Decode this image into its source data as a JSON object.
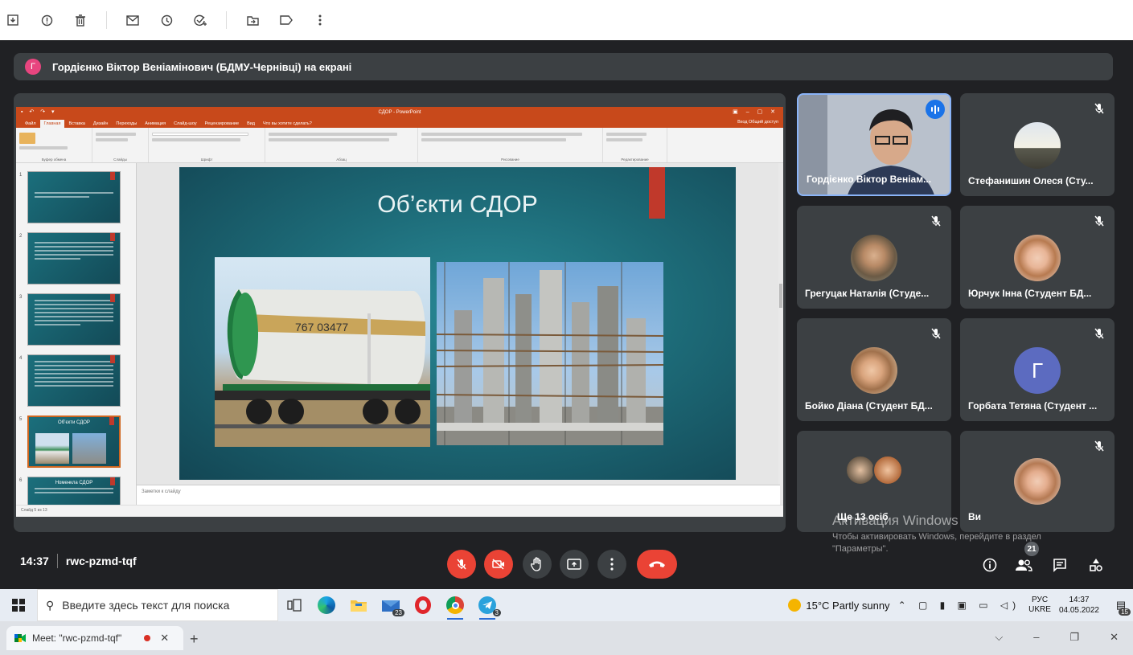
{
  "banner": {
    "avatar_letter": "Г",
    "text": "Гордієнко Віктор Веніамінович (БДМУ-Чернівці) на екрані"
  },
  "ppt": {
    "title": "СДОР - PowerPoint",
    "tabs": [
      "Файл",
      "Главная",
      "Вставка",
      "Дизайн",
      "Переходы",
      "Анимация",
      "Слайд-шоу",
      "Рецензирование",
      "Вид",
      "Что вы хотите сделать?"
    ],
    "right": "Вход  Общий доступ",
    "groups": [
      "Буфер обмена",
      "Слайды",
      "Шрифт",
      "Абзац",
      "Рисование",
      "Редактирование"
    ],
    "slide_title": "Об’єкти СДОР",
    "thumb5_title": "Об’єкти СДОР",
    "thumb6_title": "Номенкла СДОР",
    "notes": "Заметки к слайду",
    "status": "Слайд 5 из 13"
  },
  "thumbnails": [
    "1",
    "2",
    "3",
    "4",
    "5",
    "6"
  ],
  "tiles": [
    {
      "name": "Гордієнко Віктор Веніам...",
      "speaking": true
    },
    {
      "name": "Стефанишин Олеся (Сту..."
    },
    {
      "name": "Грегуцак Наталія (Студе..."
    },
    {
      "name": "Юрчук Інна (Студент БД..."
    },
    {
      "name": "Бойко Діана (Студент БД..."
    },
    {
      "name": "Горбата Тетяна (Студент ...",
      "letter": "Г"
    },
    {
      "name": "Ще 13 осіб"
    },
    {
      "name": "Ви"
    }
  ],
  "watermark": {
    "line1": "Активация Windows",
    "line2": "Чтобы активировать Windows, перейдите в раздел",
    "line3": "\"Параметры\"."
  },
  "meeting": {
    "time": "14:37",
    "code": "rwc-pzmd-tqf",
    "participants_count": "21"
  },
  "taskbar": {
    "search_placeholder": "Введите здесь текст для поиска",
    "mail_count": "23",
    "telegram_count": "3",
    "weather": "15°C  Partly sunny",
    "lang1": "РУС",
    "lang2": "UKRE",
    "time": "14:37",
    "date": "04.05.2022",
    "notif_count": "15"
  },
  "browser": {
    "tab_title": "Meet: \"rwc-pzmd-tqf\"",
    "new_tab": "+"
  },
  "colors": {
    "meet_bg": "#202124",
    "tile_bg": "#3c4043",
    "end_call": "#ea4335",
    "ppt_orange": "#c8491b"
  }
}
